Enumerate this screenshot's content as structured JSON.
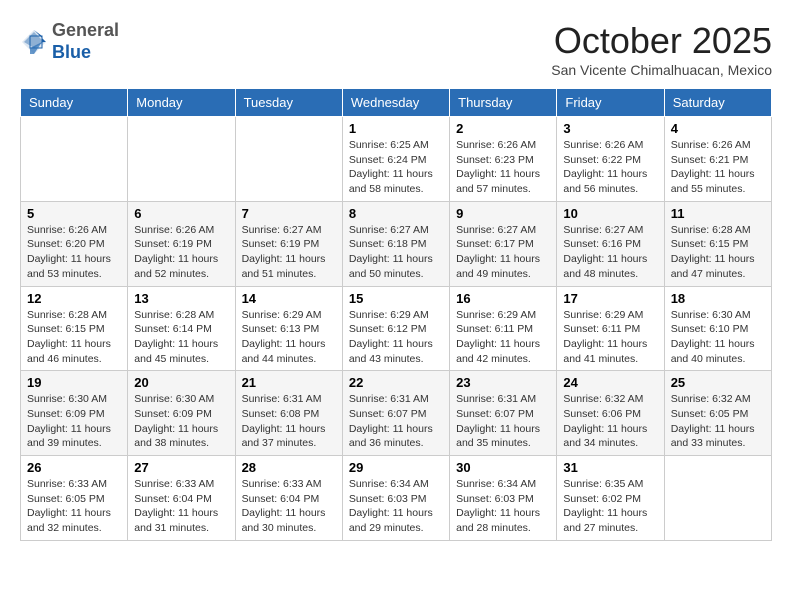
{
  "header": {
    "logo_line1": "General",
    "logo_line2": "Blue",
    "month_title": "October 2025",
    "location": "San Vicente Chimalhuacan, Mexico"
  },
  "days_of_week": [
    "Sunday",
    "Monday",
    "Tuesday",
    "Wednesday",
    "Thursday",
    "Friday",
    "Saturday"
  ],
  "weeks": [
    [
      {
        "day": "",
        "info": ""
      },
      {
        "day": "",
        "info": ""
      },
      {
        "day": "",
        "info": ""
      },
      {
        "day": "1",
        "info": "Sunrise: 6:25 AM\nSunset: 6:24 PM\nDaylight: 11 hours\nand 58 minutes."
      },
      {
        "day": "2",
        "info": "Sunrise: 6:26 AM\nSunset: 6:23 PM\nDaylight: 11 hours\nand 57 minutes."
      },
      {
        "day": "3",
        "info": "Sunrise: 6:26 AM\nSunset: 6:22 PM\nDaylight: 11 hours\nand 56 minutes."
      },
      {
        "day": "4",
        "info": "Sunrise: 6:26 AM\nSunset: 6:21 PM\nDaylight: 11 hours\nand 55 minutes."
      }
    ],
    [
      {
        "day": "5",
        "info": "Sunrise: 6:26 AM\nSunset: 6:20 PM\nDaylight: 11 hours\nand 53 minutes."
      },
      {
        "day": "6",
        "info": "Sunrise: 6:26 AM\nSunset: 6:19 PM\nDaylight: 11 hours\nand 52 minutes."
      },
      {
        "day": "7",
        "info": "Sunrise: 6:27 AM\nSunset: 6:19 PM\nDaylight: 11 hours\nand 51 minutes."
      },
      {
        "day": "8",
        "info": "Sunrise: 6:27 AM\nSunset: 6:18 PM\nDaylight: 11 hours\nand 50 minutes."
      },
      {
        "day": "9",
        "info": "Sunrise: 6:27 AM\nSunset: 6:17 PM\nDaylight: 11 hours\nand 49 minutes."
      },
      {
        "day": "10",
        "info": "Sunrise: 6:27 AM\nSunset: 6:16 PM\nDaylight: 11 hours\nand 48 minutes."
      },
      {
        "day": "11",
        "info": "Sunrise: 6:28 AM\nSunset: 6:15 PM\nDaylight: 11 hours\nand 47 minutes."
      }
    ],
    [
      {
        "day": "12",
        "info": "Sunrise: 6:28 AM\nSunset: 6:15 PM\nDaylight: 11 hours\nand 46 minutes."
      },
      {
        "day": "13",
        "info": "Sunrise: 6:28 AM\nSunset: 6:14 PM\nDaylight: 11 hours\nand 45 minutes."
      },
      {
        "day": "14",
        "info": "Sunrise: 6:29 AM\nSunset: 6:13 PM\nDaylight: 11 hours\nand 44 minutes."
      },
      {
        "day": "15",
        "info": "Sunrise: 6:29 AM\nSunset: 6:12 PM\nDaylight: 11 hours\nand 43 minutes."
      },
      {
        "day": "16",
        "info": "Sunrise: 6:29 AM\nSunset: 6:11 PM\nDaylight: 11 hours\nand 42 minutes."
      },
      {
        "day": "17",
        "info": "Sunrise: 6:29 AM\nSunset: 6:11 PM\nDaylight: 11 hours\nand 41 minutes."
      },
      {
        "day": "18",
        "info": "Sunrise: 6:30 AM\nSunset: 6:10 PM\nDaylight: 11 hours\nand 40 minutes."
      }
    ],
    [
      {
        "day": "19",
        "info": "Sunrise: 6:30 AM\nSunset: 6:09 PM\nDaylight: 11 hours\nand 39 minutes."
      },
      {
        "day": "20",
        "info": "Sunrise: 6:30 AM\nSunset: 6:09 PM\nDaylight: 11 hours\nand 38 minutes."
      },
      {
        "day": "21",
        "info": "Sunrise: 6:31 AM\nSunset: 6:08 PM\nDaylight: 11 hours\nand 37 minutes."
      },
      {
        "day": "22",
        "info": "Sunrise: 6:31 AM\nSunset: 6:07 PM\nDaylight: 11 hours\nand 36 minutes."
      },
      {
        "day": "23",
        "info": "Sunrise: 6:31 AM\nSunset: 6:07 PM\nDaylight: 11 hours\nand 35 minutes."
      },
      {
        "day": "24",
        "info": "Sunrise: 6:32 AM\nSunset: 6:06 PM\nDaylight: 11 hours\nand 34 minutes."
      },
      {
        "day": "25",
        "info": "Sunrise: 6:32 AM\nSunset: 6:05 PM\nDaylight: 11 hours\nand 33 minutes."
      }
    ],
    [
      {
        "day": "26",
        "info": "Sunrise: 6:33 AM\nSunset: 6:05 PM\nDaylight: 11 hours\nand 32 minutes."
      },
      {
        "day": "27",
        "info": "Sunrise: 6:33 AM\nSunset: 6:04 PM\nDaylight: 11 hours\nand 31 minutes."
      },
      {
        "day": "28",
        "info": "Sunrise: 6:33 AM\nSunset: 6:04 PM\nDaylight: 11 hours\nand 30 minutes."
      },
      {
        "day": "29",
        "info": "Sunrise: 6:34 AM\nSunset: 6:03 PM\nDaylight: 11 hours\nand 29 minutes."
      },
      {
        "day": "30",
        "info": "Sunrise: 6:34 AM\nSunset: 6:03 PM\nDaylight: 11 hours\nand 28 minutes."
      },
      {
        "day": "31",
        "info": "Sunrise: 6:35 AM\nSunset: 6:02 PM\nDaylight: 11 hours\nand 27 minutes."
      },
      {
        "day": "",
        "info": ""
      }
    ]
  ]
}
